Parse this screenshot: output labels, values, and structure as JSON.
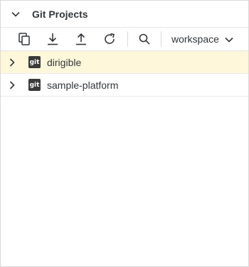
{
  "panel": {
    "title": "Git Projects"
  },
  "toolbar": {
    "buttons": [
      {
        "name": "copy-icon"
      },
      {
        "name": "download-icon"
      },
      {
        "name": "upload-icon"
      },
      {
        "name": "refresh-icon"
      },
      {
        "name": "search-icon"
      }
    ],
    "workspace_select": {
      "value": "workspace"
    }
  },
  "projects": [
    {
      "badge": "git",
      "label": "dirigible",
      "selected": true
    },
    {
      "badge": "git",
      "label": "sample-platform",
      "selected": false
    }
  ],
  "colors": {
    "selected_row": "#fef7da",
    "border": "#d9d9d9",
    "text": "#32363a",
    "badge_bg": "#3a3a3a"
  }
}
